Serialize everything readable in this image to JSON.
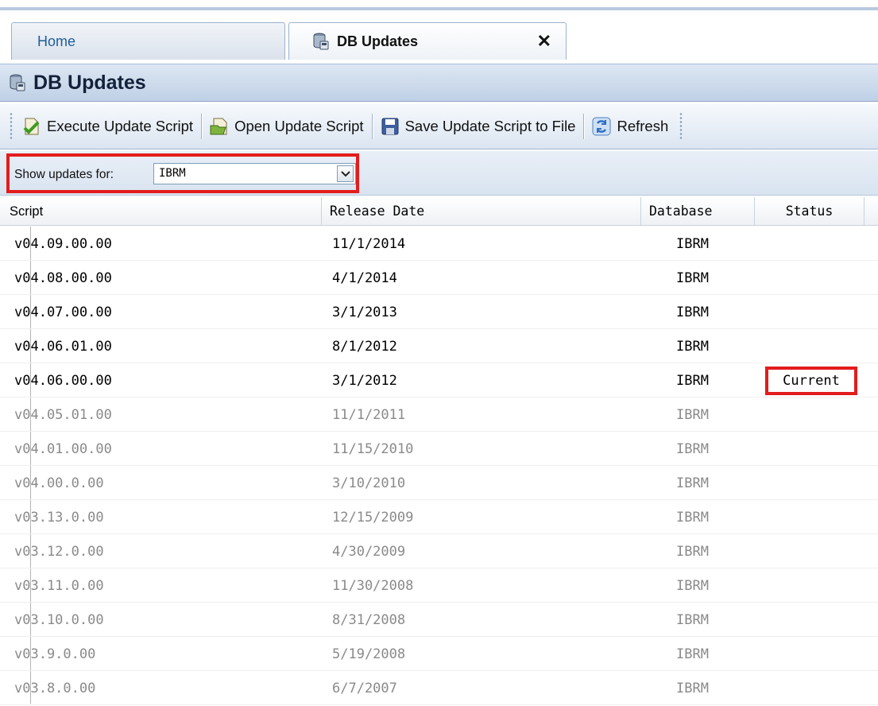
{
  "tabs": [
    {
      "label": "Home",
      "active": false
    },
    {
      "label": "DB Updates",
      "active": true,
      "close": "✕"
    }
  ],
  "title": "DB Updates",
  "toolbar": {
    "execute": "Execute Update Script",
    "open": "Open Update Script",
    "save": "Save Update Script to File",
    "refresh": "Refresh"
  },
  "filter": {
    "label": "Show updates for:",
    "value": "IBRM"
  },
  "columns": {
    "script": "Script",
    "date": "Release Date",
    "database": "Database",
    "status": "Status"
  },
  "rows": [
    {
      "script": "v04.09.00.00",
      "date": "11/1/2014",
      "database": "IBRM",
      "status": "",
      "old": false
    },
    {
      "script": "v04.08.00.00",
      "date": "4/1/2014",
      "database": "IBRM",
      "status": "",
      "old": false
    },
    {
      "script": "v04.07.00.00",
      "date": "3/1/2013",
      "database": "IBRM",
      "status": "",
      "old": false
    },
    {
      "script": "v04.06.01.00",
      "date": "8/1/2012",
      "database": "IBRM",
      "status": "",
      "old": false
    },
    {
      "script": "v04.06.00.00",
      "date": "3/1/2012",
      "database": "IBRM",
      "status": "Current",
      "old": false
    },
    {
      "script": "v04.05.01.00",
      "date": "11/1/2011",
      "database": "IBRM",
      "status": "",
      "old": true
    },
    {
      "script": "v04.01.00.00",
      "date": "11/15/2010",
      "database": "IBRM",
      "status": "",
      "old": true
    },
    {
      "script": "v04.00.0.00",
      "date": "3/10/2010",
      "database": "IBRM",
      "status": "",
      "old": true
    },
    {
      "script": "v03.13.0.00",
      "date": "12/15/2009",
      "database": "IBRM",
      "status": "",
      "old": true
    },
    {
      "script": "v03.12.0.00",
      "date": "4/30/2009",
      "database": "IBRM",
      "status": "",
      "old": true
    },
    {
      "script": "v03.11.0.00",
      "date": "11/30/2008",
      "database": "IBRM",
      "status": "",
      "old": true
    },
    {
      "script": "v03.10.0.00",
      "date": "8/31/2008",
      "database": "IBRM",
      "status": "",
      "old": true
    },
    {
      "script": "v03.9.0.00",
      "date": "5/19/2008",
      "database": "IBRM",
      "status": "",
      "old": true
    },
    {
      "script": "v03.8.0.00",
      "date": "6/7/2007",
      "database": "IBRM",
      "status": "",
      "old": true
    }
  ],
  "colors": {
    "highlight": "#e31c1c",
    "superseded_text": "#8a8a8a"
  }
}
